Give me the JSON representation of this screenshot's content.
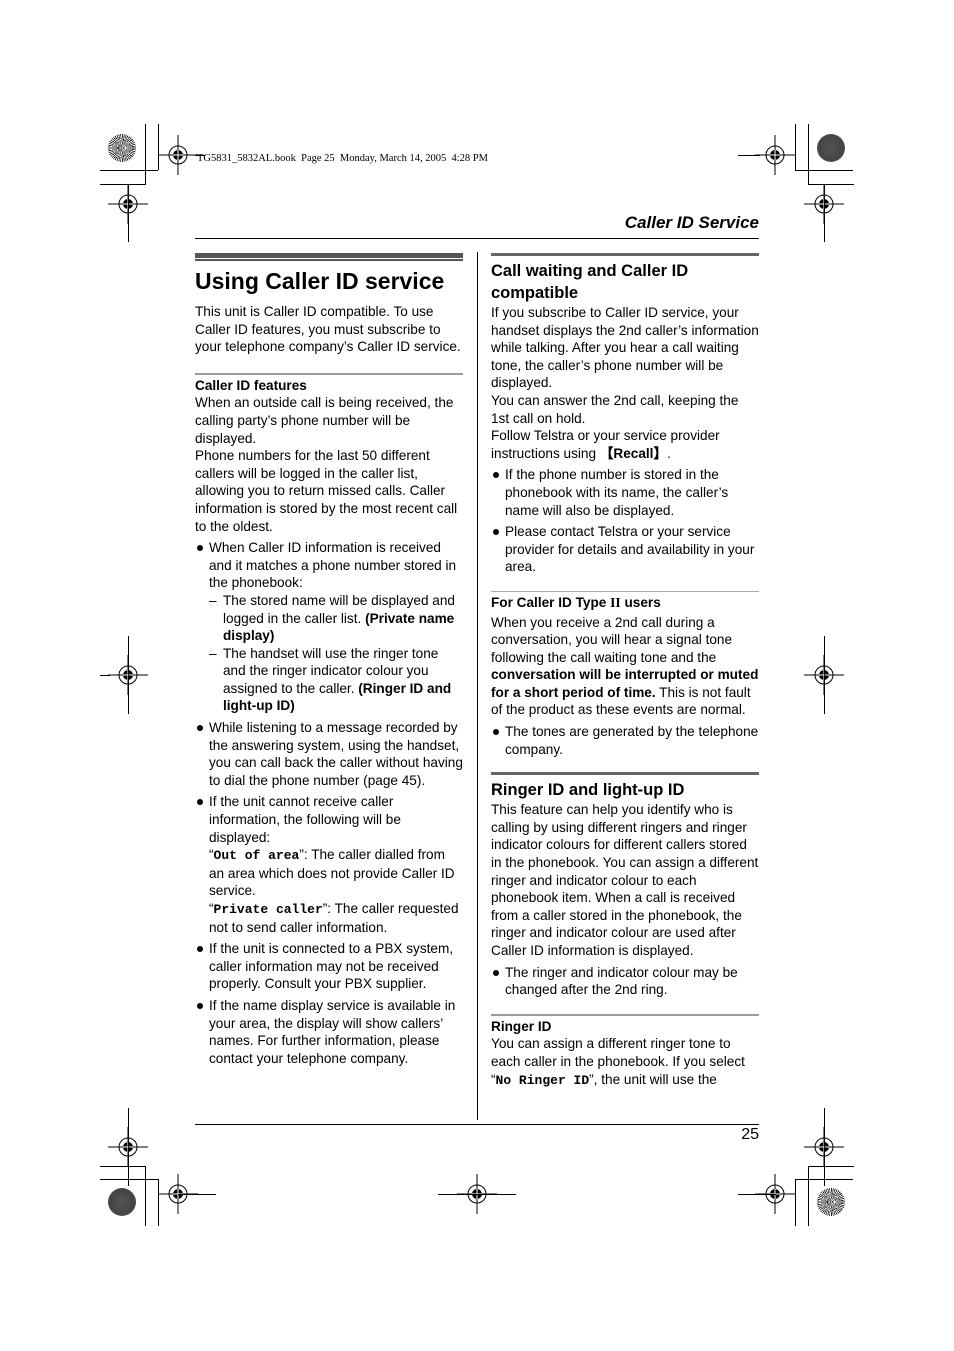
{
  "print_marks": {
    "book_note": "TG5831_5832AL.book  Page 25  Monday, March 14, 2005  4:28 PM"
  },
  "header": {
    "running_title": "Caller ID Service"
  },
  "footer": {
    "page_number": "25"
  },
  "left_column": {
    "title": "Using Caller ID service",
    "intro": "This unit is Caller ID compatible. To use Caller ID features, you must subscribe to your telephone company’s Caller ID service.",
    "features": {
      "heading": "Caller ID features",
      "para1": "When an outside call is being received, the calling party’s phone number will be displayed.",
      "para2": "Phone numbers for the last 50 different callers will be logged in the caller list, allowing you to return missed calls. Caller information is stored by the most recent call to the oldest.",
      "bullet1": {
        "text": "When Caller ID information is received and it matches a phone number stored in the phonebook:",
        "sub1_text": "The stored name will be displayed and logged in the caller list. ",
        "sub1_bold": "(Private name display)",
        "sub2_text": "The handset will use the ringer tone and the ringer indicator colour you assigned to the caller. ",
        "sub2_bold": "(Ringer ID and light-up ID)"
      },
      "bullet2": "While listening to a message recorded by the answering system, using the handset, you can call back the caller without having to dial the phone number (page 45).",
      "bullet3": {
        "text": "If the unit cannot receive caller information, the following will be displayed:",
        "out_of_area_label": "Out of area",
        "out_of_area_desc": ": The caller dialled from an area which does not provide Caller ID service.",
        "private_label": "Private caller",
        "private_desc": ": The caller requested not to send caller information."
      },
      "bullet4": "If the unit is connected to a PBX system, caller information may not be received properly. Consult your PBX supplier.",
      "bullet5": "If the name display service is available in your area, the display will show callers’ names. For further information, please contact your telephone company."
    }
  },
  "right_column": {
    "call_waiting": {
      "title": "Call waiting and Caller ID compatible",
      "para1": "If you subscribe to Caller ID service, your handset displays the 2nd caller’s information while talking. After you hear a call waiting tone, the caller’s phone number will be displayed.",
      "para2": "You can answer the 2nd call, keeping the 1st call on hold.",
      "para3_text": "Follow Telstra or your service provider instructions using ",
      "para3_key": "【Recall】",
      "para3_end": ".",
      "bullet1": "If the phone number is stored in the phonebook with its name, the caller’s name will also be displayed.",
      "bullet2": "Please contact Telstra or your service provider for details and availability in your area."
    },
    "type2": {
      "heading_pre": "For Caller ID Type ",
      "heading_numeral": "II",
      "heading_post": " users",
      "para_text": "When you receive a 2nd call during a conversation, you will hear a signal tone following the call waiting tone and the ",
      "para_bold": "conversation will be interrupted or muted for a short period of time.",
      "para_end": " This is not fault of the product as these events are normal.",
      "bullet1": "The tones are generated by the telephone company."
    },
    "ringer_light": {
      "title": "Ringer ID and light-up ID",
      "para": "This feature can help you identify who is calling by using different ringers and ringer indicator colours for different callers stored in the phonebook. You can assign a different ringer and indicator colour to each phonebook item. When a call is received from a caller stored in the phonebook, the ringer and indicator colour are used after Caller ID information is displayed.",
      "bullet1": "The ringer and indicator colour may be changed after the 2nd ring."
    },
    "ringer_id": {
      "heading": "Ringer ID",
      "para_text": "You can assign a different ringer tone to each caller in the phonebook. If you select “",
      "para_mono": "No Ringer ID",
      "para_end": "”, the unit will use the"
    }
  }
}
